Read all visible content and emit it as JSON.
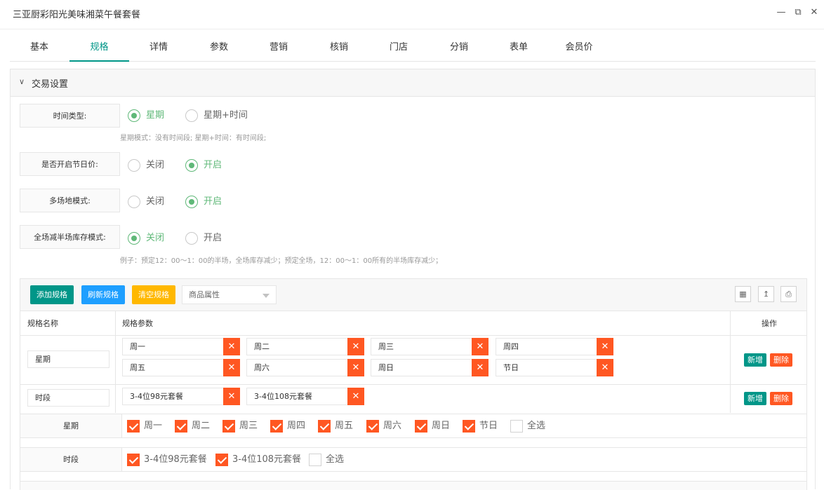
{
  "window": {
    "title": "三亚厨彩阳光美味湘菜午餐套餐",
    "min_icon": "minimize-icon",
    "max_icon": "maximize-icon",
    "close_icon": "close-icon"
  },
  "tabs": [
    {
      "label": "基本"
    },
    {
      "label": "规格"
    },
    {
      "label": "详情"
    },
    {
      "label": "参数"
    },
    {
      "label": "营销"
    },
    {
      "label": "核销"
    },
    {
      "label": "门店"
    },
    {
      "label": "分销"
    },
    {
      "label": "表单"
    },
    {
      "label": "会员价"
    }
  ],
  "active_tab": "规格",
  "section": {
    "title": "交易设置"
  },
  "fields": {
    "time_type": {
      "label": "时间类型:",
      "opt1": "星期",
      "opt2": "星期+时间",
      "selected": "星期",
      "hint": "星期模式：没有时间段; 星期+时间：有时间段;"
    },
    "holiday_price": {
      "label": "是否开启节日价:",
      "opt1": "关闭",
      "opt2": "开启",
      "selected": "开启"
    },
    "multi_venue": {
      "label": "多场地模式:",
      "opt1": "关闭",
      "opt2": "开启",
      "selected": "开启"
    },
    "stock_mode": {
      "label": "全场减半场库存模式:",
      "opt1": "关闭",
      "opt2": "开启",
      "selected": "关闭",
      "hint": "例子：预定12：00～1：00的半场，全场库存减少；预定全场，12：00～1：00所有的半场库存减少；"
    }
  },
  "spec": {
    "add_btn": "添加规格",
    "refresh_btn": "刷新规格",
    "clear_btn": "清空规格",
    "attr_select": "商品属性",
    "header": {
      "name": "规格名称",
      "params": "规格参数",
      "action": "操作"
    },
    "rows": [
      {
        "name": "星期",
        "params": [
          "周一",
          "周二",
          "周三",
          "周四",
          "周五",
          "周六",
          "周日",
          "节日"
        ]
      },
      {
        "name": "时段",
        "params": [
          "3-4位98元套餐",
          "3-4位108元套餐"
        ]
      }
    ],
    "add_label": "新增",
    "delete_label": "删除"
  },
  "checks": {
    "week": {
      "label": "星期",
      "items": [
        "周一",
        "周二",
        "周三",
        "周四",
        "周五",
        "周六",
        "周日",
        "节日",
        "全选"
      ]
    },
    "period": {
      "label": "时段",
      "items": [
        "3-4位98元套餐",
        "3-4位108元套餐",
        "全选"
      ]
    }
  },
  "colors": {
    "accent": "#009688",
    "radio": "#5FB878",
    "danger": "#FF5722",
    "blue": "#1E9FFF",
    "warm": "#FFB800"
  }
}
